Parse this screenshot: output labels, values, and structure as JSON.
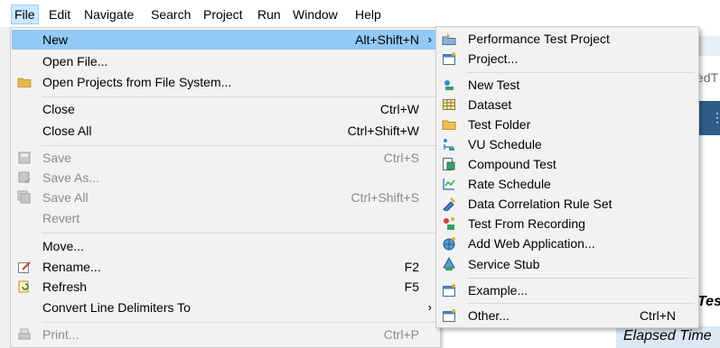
{
  "menubar": {
    "items": [
      "File",
      "Edit",
      "Navigate",
      "Search",
      "Project",
      "Run",
      "Window",
      "Help"
    ]
  },
  "file_menu": {
    "new": {
      "label": "New",
      "accel": "Alt+Shift+N"
    },
    "open_file": {
      "label": "Open File..."
    },
    "open_projects": {
      "label": "Open Projects from File System..."
    },
    "close": {
      "label": "Close",
      "accel": "Ctrl+W"
    },
    "close_all": {
      "label": "Close All",
      "accel": "Ctrl+Shift+W"
    },
    "save": {
      "label": "Save",
      "accel": "Ctrl+S"
    },
    "save_as": {
      "label": "Save As..."
    },
    "save_all": {
      "label": "Save All",
      "accel": "Ctrl+Shift+S"
    },
    "revert": {
      "label": "Revert"
    },
    "move": {
      "label": "Move..."
    },
    "rename": {
      "label": "Rename...",
      "accel": "F2"
    },
    "refresh": {
      "label": "Refresh",
      "accel": "F5"
    },
    "convert": {
      "label": "Convert Line Delimiters To"
    },
    "print": {
      "label": "Print...",
      "accel": "Ctrl+P"
    }
  },
  "new_submenu": {
    "performance_test_project": "Performance Test Project",
    "project": "Project...",
    "new_test": "New Test",
    "dataset": "Dataset",
    "test_folder": "Test Folder",
    "vu_schedule": "VU Schedule",
    "compound_test": "Compound Test",
    "rate_schedule": "Rate Schedule",
    "data_correlation_rule_set": "Data Correlation Rule Set",
    "test_from_recording": "Test From Recording",
    "add_web_application": "Add Web Application...",
    "service_stub": "Service Stub",
    "example": "Example...",
    "other": {
      "label": "Other...",
      "accel": "Ctrl+N"
    }
  },
  "background": {
    "tab_fragment": "edT",
    "heading_fragment": "Tes",
    "elapsed_time": "Elapsed Time"
  },
  "colors": {
    "highlight": "#91c9f7",
    "menubar_active": "#cce8ff",
    "menu_bg": "#f2f2f2",
    "disabled_text": "#8c8c8c"
  }
}
